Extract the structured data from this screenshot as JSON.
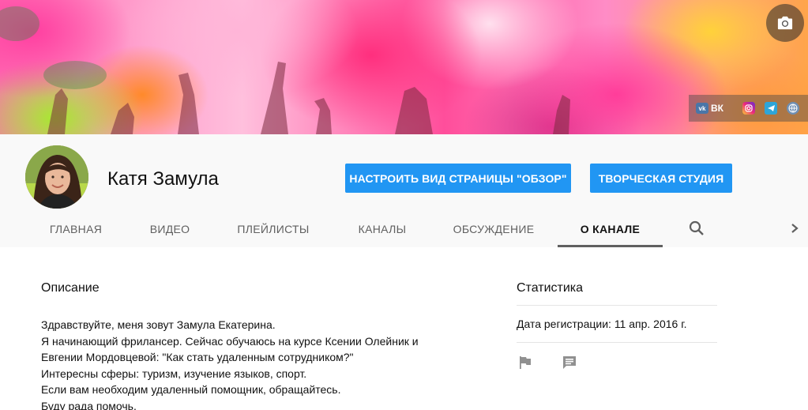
{
  "banner": {
    "camera_icon": "camera-icon",
    "social": {
      "vk_label": "ВК",
      "vk_badge": "vk",
      "icons": [
        "vk-icon",
        "instagram-icon",
        "telegram-icon",
        "globe-icon"
      ]
    }
  },
  "channel": {
    "name": "Катя Замула",
    "customize_button": "НАСТРОИТЬ ВИД СТРАНИЦЫ \"ОБЗОР\"",
    "studio_button": "ТВОРЧЕСКАЯ СТУДИЯ",
    "accent_color": "#2196f3"
  },
  "tabs": [
    {
      "label": "ГЛАВНАЯ",
      "active": false
    },
    {
      "label": "ВИДЕО",
      "active": false
    },
    {
      "label": "ПЛЕЙЛИСТЫ",
      "active": false
    },
    {
      "label": "КАНАЛЫ",
      "active": false
    },
    {
      "label": "ОБСУЖДЕНИЕ",
      "active": false
    },
    {
      "label": "О КАНАЛЕ",
      "active": true
    }
  ],
  "tab_icons": {
    "search": "search-icon",
    "next": "chevron-right-icon"
  },
  "about": {
    "description_heading": "Описание",
    "description_lines": [
      "Здравствуйте, меня зовут Замула Екатерина.",
      "Я начинающий фрилансер. Сейчас обучаюсь на курсе Ксении Олейник и",
      "Евгении Мордовцевой: \"Как стать удаленным сотрудником?\"",
      "Интересны сферы: туризм, изучение языков, спорт.",
      "Если вам необходим удаленный помощник, обращайтесь.",
      "Буду рада помочь."
    ],
    "stats_heading": "Статистика",
    "registered": "Дата регистрации: 11 апр. 2016 г.",
    "action_icons": [
      "flag-icon",
      "message-icon"
    ]
  }
}
